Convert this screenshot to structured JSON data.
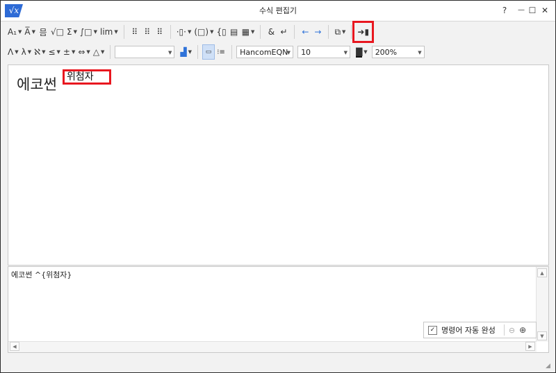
{
  "window": {
    "title": "수식 편집기",
    "app_icon": "√x",
    "help": "?",
    "minimize": "—",
    "maximize": "☐",
    "close": "✕"
  },
  "toolbar1": [
    {
      "name": "subscript-superscript-button",
      "glyph": "A₁",
      "dd": true
    },
    {
      "name": "decoration-button",
      "glyph": "A̅",
      "dd": true
    },
    {
      "name": "fraction-button",
      "glyph": "믐"
    },
    {
      "name": "root-button",
      "glyph": "√□"
    },
    {
      "name": "sum-button",
      "glyph": "Σ",
      "dd": true
    },
    {
      "name": "integral-button",
      "glyph": "∫□",
      "dd": true
    },
    {
      "name": "limit-button",
      "glyph": "lim",
      "dd": true
    },
    {
      "sep": true
    },
    {
      "name": "matrix-button-1",
      "glyph": "⠿"
    },
    {
      "name": "matrix-button-2",
      "glyph": "⠿"
    },
    {
      "name": "matrix-button-3",
      "glyph": "⠿"
    },
    {
      "sep": true
    },
    {
      "name": "bracket-button-1",
      "glyph": "·▯·",
      "dd": true
    },
    {
      "name": "bracket-button-2",
      "glyph": "(□)",
      "dd": true
    },
    {
      "name": "bracket-button-3",
      "glyph": "{▯"
    },
    {
      "name": "matrix-grid-button",
      "glyph": "▤"
    },
    {
      "name": "matrix-grid-button-2",
      "glyph": "▦",
      "dd": true
    },
    {
      "sep": true
    },
    {
      "name": "align-ampersand-button",
      "glyph": "&"
    },
    {
      "name": "newline-button",
      "glyph": "↵"
    },
    {
      "sep": true
    },
    {
      "name": "prev-button",
      "glyph": "←",
      "blue": true
    },
    {
      "name": "next-button",
      "glyph": "→",
      "blue": true
    },
    {
      "sep": true
    },
    {
      "name": "insert-function-button",
      "glyph": "⧉",
      "dd": true
    },
    {
      "sep": true
    },
    {
      "name": "save-exit-button",
      "glyph": "➜▮",
      "hl": true
    }
  ],
  "toolbar2": [
    {
      "name": "greek-upper-button",
      "glyph": "Λ",
      "dd": true
    },
    {
      "name": "greek-lower-button",
      "glyph": "λ",
      "dd": true
    },
    {
      "name": "hebrew-symbol-button",
      "glyph": "ℵ",
      "dd": true
    },
    {
      "name": "relation-button",
      "glyph": "≤",
      "dd": true
    },
    {
      "name": "operator-button",
      "glyph": "±",
      "dd": true
    },
    {
      "name": "arrow-button",
      "glyph": "⇔",
      "dd": true
    },
    {
      "name": "misc-symbol-button",
      "glyph": "△",
      "dd": true
    }
  ],
  "combos": {
    "style_value": "",
    "font_value": "HancomEQN",
    "size_value": "10",
    "zoom_value": "200%"
  },
  "editor": {
    "base_text": "에코썬",
    "sup_text": "위첨자"
  },
  "script": {
    "text": "에코썬 ^{위첨자}"
  },
  "autocomplete": {
    "label": "명령어 자동 완성",
    "checked": "✓"
  }
}
